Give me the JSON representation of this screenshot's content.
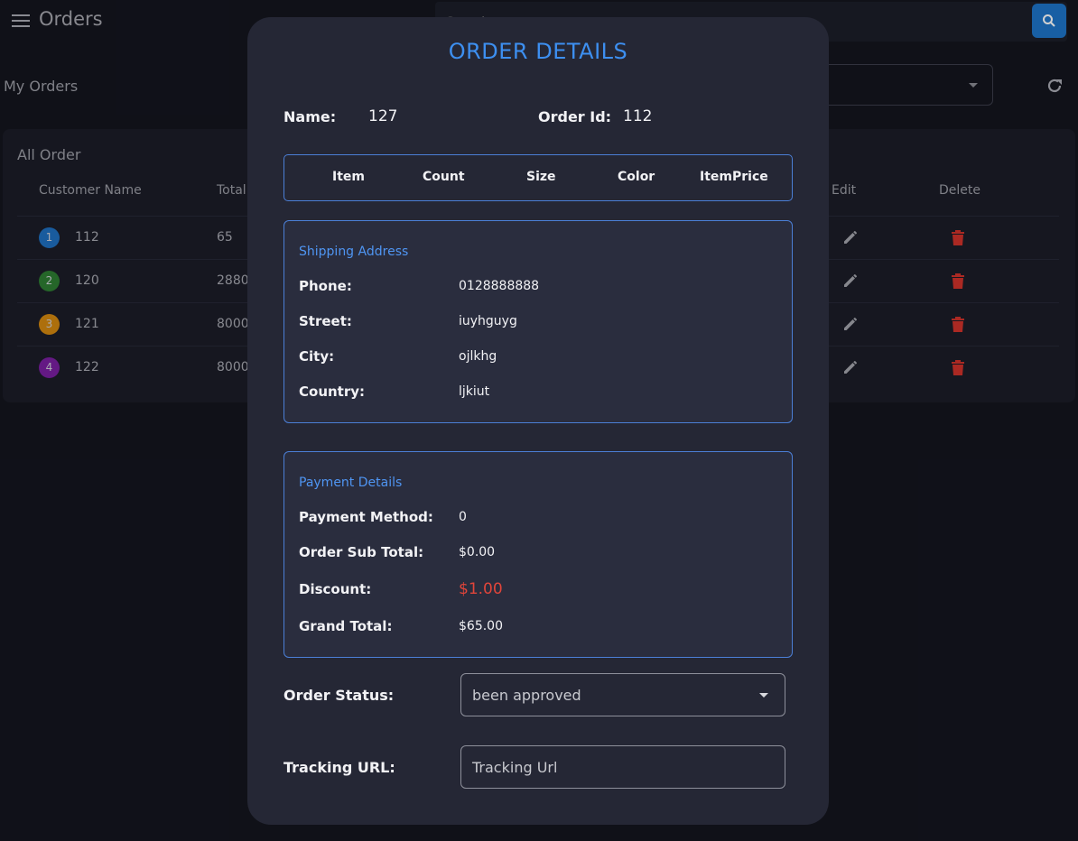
{
  "app": {
    "title": "Orders"
  },
  "search": {
    "placeholder": "Search"
  },
  "page": {
    "section_title": "My Orders"
  },
  "orders_card": {
    "title": "All Order",
    "columns": {
      "customer_name": "Customer Name",
      "total": "Total",
      "edit": "Edit",
      "delete": "Delete"
    },
    "rows": [
      {
        "index": "1",
        "customer": "112",
        "total": "65",
        "badge_color": "#1f6fc0"
      },
      {
        "index": "2",
        "customer": "120",
        "total": "2880",
        "badge_color": "#2e7d32"
      },
      {
        "index": "3",
        "customer": "121",
        "total": "8000",
        "badge_color": "#d4880f"
      },
      {
        "index": "4",
        "customer": "122",
        "total": "8000",
        "badge_color": "#7b1fa2"
      }
    ]
  },
  "modal": {
    "title": "ORDER DETAILS",
    "name_label": "Name:",
    "name_value": "127",
    "order_id_label": "Order Id:",
    "order_id_value": "112",
    "items_headers": [
      "Item",
      "Count",
      "Size",
      "Color",
      "ItemPrice"
    ],
    "shipping": {
      "title": "Shipping Address",
      "phone_label": "Phone:",
      "phone": "0128888888",
      "street_label": "Street:",
      "street": "iuyhguyg",
      "city_label": "City:",
      "city": "ojlkhg",
      "country_label": "Country:",
      "country": "ljkiut"
    },
    "payment": {
      "title": "Payment Details",
      "method_label": "Payment Method:",
      "method": "0",
      "subtotal_label": "Order Sub Total:",
      "subtotal": "$0.00",
      "discount_label": "Discount:",
      "discount": "$1.00",
      "grand_total_label": "Grand Total:",
      "grand_total": "$65.00"
    },
    "order_status_label": "Order Status:",
    "order_status_value": "been approved",
    "tracking_label": "Tracking URL:",
    "tracking_placeholder": "Tracking Url"
  },
  "colors": {
    "accent": "#3d8ff0",
    "danger": "#e0453a",
    "primary_button": "#1e74c8"
  },
  "icons": [
    "menu-icon",
    "search-icon",
    "refresh-icon",
    "pencil-icon",
    "trash-icon",
    "caret-down-icon"
  ]
}
